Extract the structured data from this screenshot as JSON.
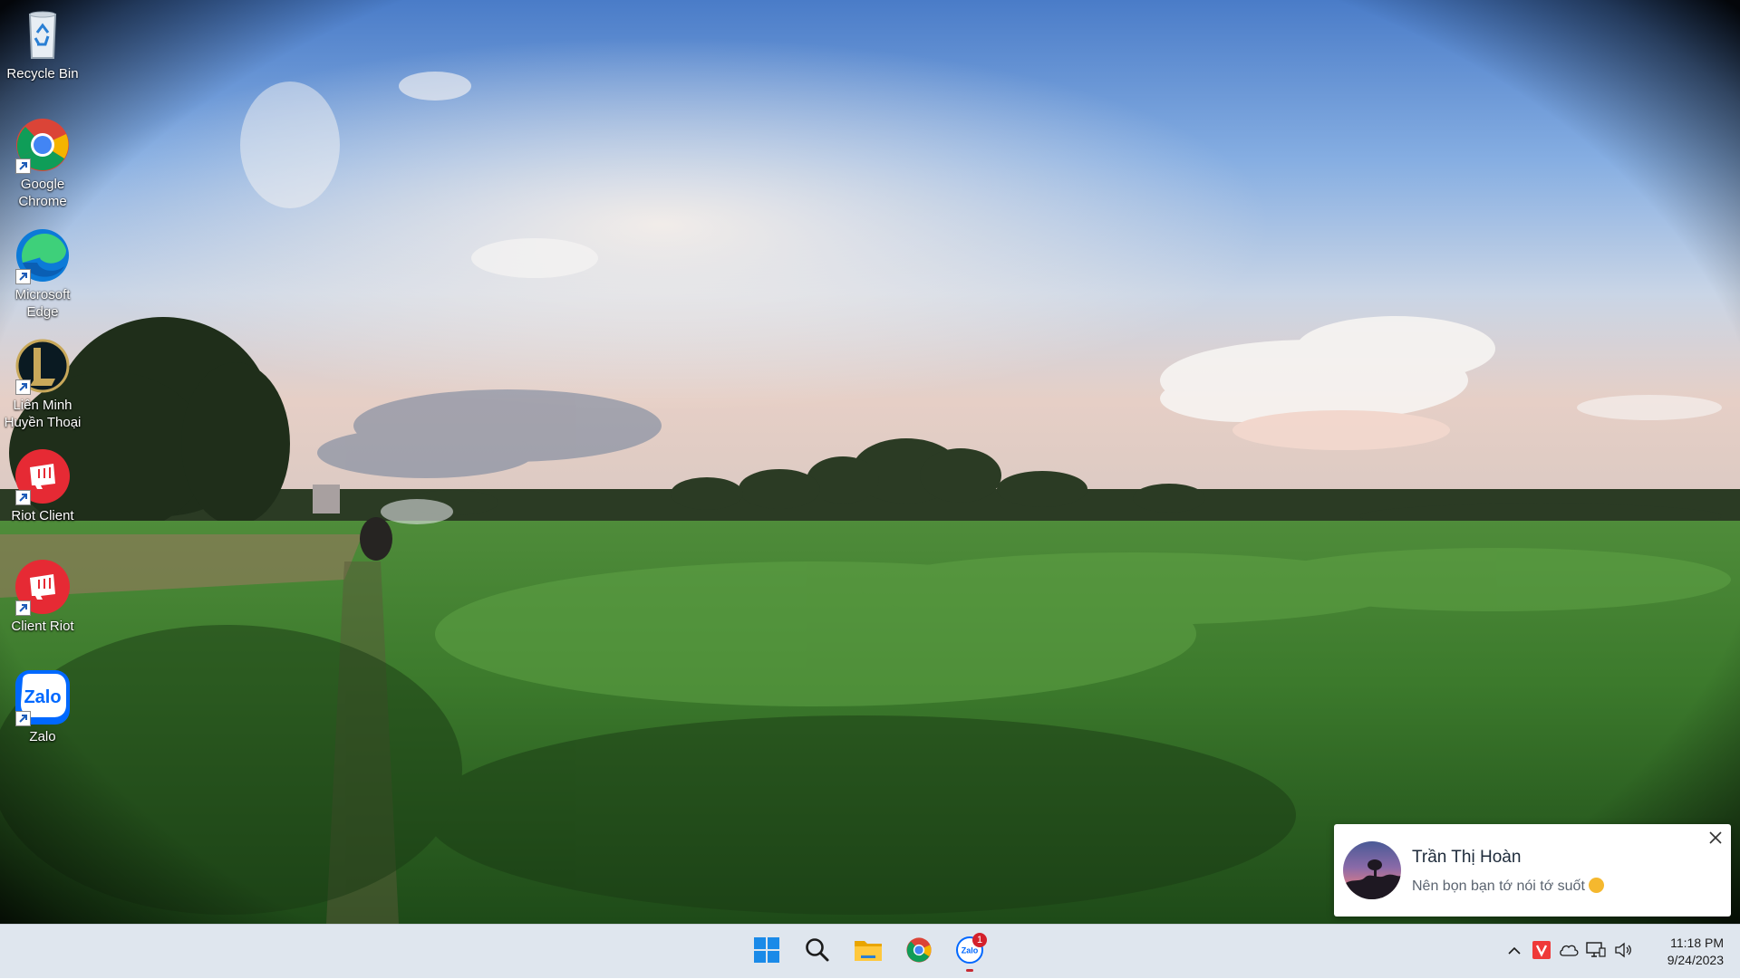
{
  "desktop": {
    "icons": [
      {
        "label": "Recycle Bin",
        "icon": "recycle-bin-icon"
      },
      {
        "label": "Google Chrome",
        "icon": "chrome-icon"
      },
      {
        "label": "Microsoft Edge",
        "icon": "edge-icon"
      },
      {
        "label": "Liên Minh Huyền Thoại",
        "icon": "league-of-legends-icon"
      },
      {
        "label": "Riot Client",
        "icon": "riot-client-icon"
      },
      {
        "label": "Client Riot",
        "icon": "riot-client-icon"
      },
      {
        "label": "Zalo",
        "icon": "zalo-icon"
      }
    ]
  },
  "taskbar": {
    "pinned": [
      {
        "name": "Start",
        "icon": "windows-start-icon"
      },
      {
        "name": "Search",
        "icon": "search-icon"
      },
      {
        "name": "File Explorer",
        "icon": "folder-icon"
      },
      {
        "name": "Google Chrome",
        "icon": "chrome-icon"
      },
      {
        "name": "Zalo",
        "icon": "zalo-icon",
        "badge": "1"
      }
    ],
    "tray": {
      "icons": [
        "chevron-up-icon",
        "vivaldi-icon",
        "onedrive-cloud-icon",
        "network-icon",
        "volume-icon"
      ],
      "time": "11:18 PM",
      "date": "9/24/2023"
    }
  },
  "notification": {
    "sender": "Trần Thị Hoàn",
    "message": "Nên bọn bạn tớ nói tớ suốt"
  },
  "colors": {
    "taskbar_bg": "#dfe6ee",
    "badge": "#d4202b",
    "accent_windows": "#1a8ae8"
  }
}
